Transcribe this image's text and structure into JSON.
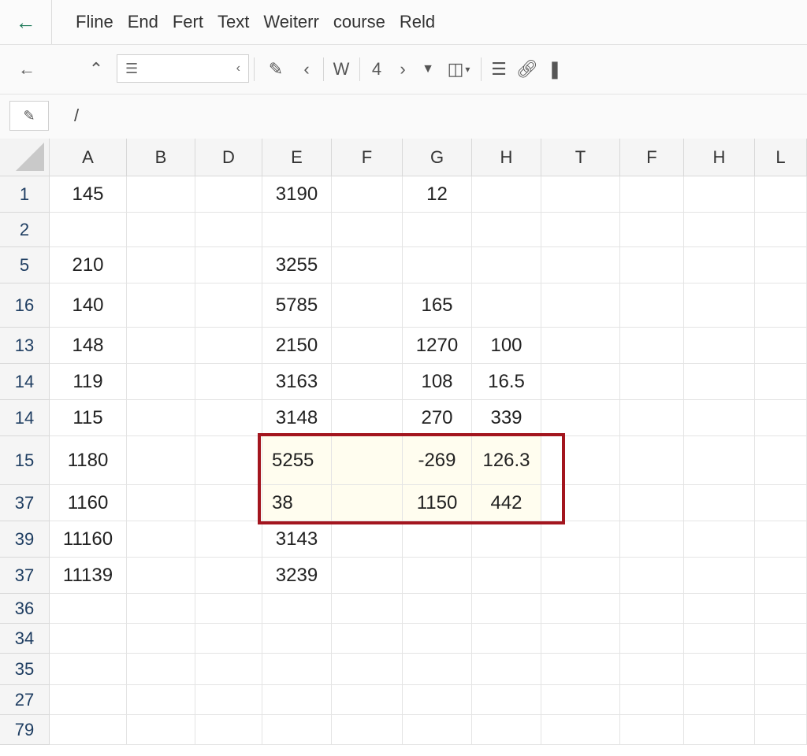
{
  "menu": {
    "back_icon": "arrow-left-icon",
    "items": [
      "Fline",
      "End",
      "Fert",
      "Text",
      "Weiterr",
      "course",
      "Reld"
    ]
  },
  "toolbar": {
    "tool_labels": {
      "w": "W",
      "four": "4"
    }
  },
  "formula": {
    "value": "/"
  },
  "grid": {
    "columns": [
      "A",
      "B",
      "D",
      "E",
      "F",
      "G",
      "H",
      "T",
      "F",
      "H",
      "L"
    ],
    "rows": [
      {
        "label": "1",
        "cells": {
          "0": "145",
          "3": "3190",
          "5": "12"
        }
      },
      {
        "label": "2",
        "cells": {}
      },
      {
        "label": "5",
        "cells": {
          "0": "210",
          "3": "3255"
        }
      },
      {
        "label": "16",
        "cells": {
          "0": "140",
          "3": "5785",
          "5": "165"
        }
      },
      {
        "label": "13",
        "cells": {
          "0": "148",
          "3": "2150",
          "5": "1270",
          "6": "100"
        }
      },
      {
        "label": "14",
        "cells": {
          "0": "119",
          "3": "3163",
          "5": "108",
          "6": "16.5"
        }
      },
      {
        "label": "14",
        "cells": {
          "0": "115",
          "3": "3148",
          "5": "270",
          "6": "339"
        }
      },
      {
        "label": "15",
        "cells": {
          "0": "1180",
          "3": "5255",
          "5": "-269",
          "6": "126.3"
        }
      },
      {
        "label": "37",
        "cells": {
          "0": "1160",
          "3": "38",
          "5": "1150",
          "6": "442"
        }
      },
      {
        "label": "39",
        "cells": {
          "0": "11160",
          "3": "3143"
        }
      },
      {
        "label": "37",
        "cells": {
          "0": "11139",
          "3": "3239"
        }
      },
      {
        "label": "36",
        "cells": {}
      },
      {
        "label": "34",
        "cells": {}
      },
      {
        "label": "35",
        "cells": {}
      },
      {
        "label": "27",
        "cells": {}
      },
      {
        "label": "79",
        "cells": {}
      }
    ],
    "selection_color": "#a3151e"
  }
}
